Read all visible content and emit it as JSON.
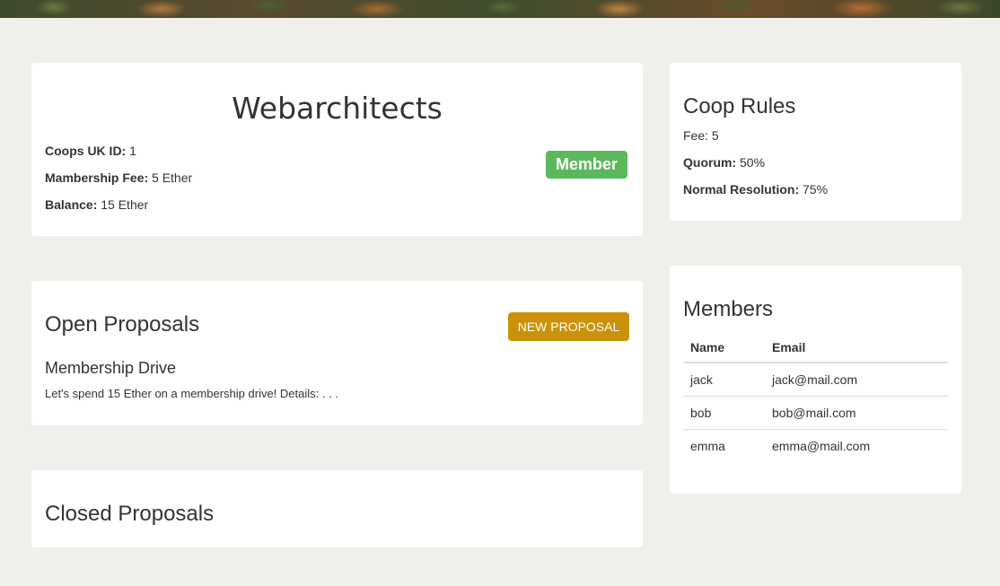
{
  "coop": {
    "name": "Webarchitects",
    "uk_id_label": "Coops UK ID:",
    "uk_id_value": " 1",
    "fee_label": "Mambership Fee:",
    "fee_value": " 5 Ether",
    "balance_label": "Balance:",
    "balance_value": " 15 Ether",
    "badge": "Member",
    "badge_color": "#5cb85c"
  },
  "open_proposals": {
    "title": "Open Proposals",
    "new_button": "NEW PROPOSAL",
    "button_color": "#c9920a",
    "items": [
      {
        "title": "Membership Drive",
        "description": "Let's spend 15 Ether on a membership drive! Details: . . ."
      }
    ]
  },
  "closed_proposals": {
    "title": "Closed Proposals"
  },
  "rules": {
    "title": "Coop Rules",
    "fee_text": "Fee: 5",
    "quorum_label": "Quorum:",
    "quorum_value": " 50%",
    "resolution_label": "Normal Resolution:",
    "resolution_value": " 75%"
  },
  "members": {
    "title": "Members",
    "columns": [
      "Name",
      "Email"
    ],
    "rows": [
      {
        "name": "jack",
        "email": "jack@mail.com"
      },
      {
        "name": "bob",
        "email": "bob@mail.com"
      },
      {
        "name": "emma",
        "email": "emma@mail.com"
      }
    ]
  }
}
